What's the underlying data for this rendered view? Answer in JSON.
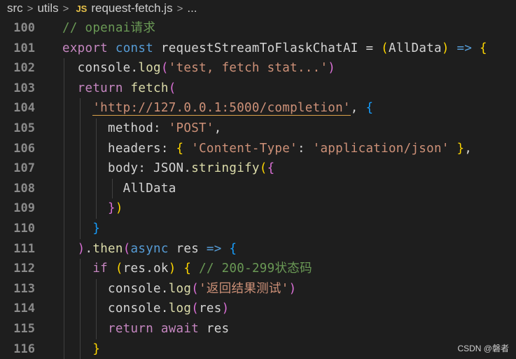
{
  "breadcrumb": {
    "items": [
      "src",
      "utils",
      "JS",
      "request-fetch.js",
      "..."
    ]
  },
  "editor": {
    "lines": [
      {
        "num": "100",
        "tokens": [
          {
            "t": "// openai请求",
            "c": "t-com"
          }
        ]
      },
      {
        "num": "101",
        "tokens": [
          {
            "t": "export",
            "c": "t-ctl"
          },
          {
            "t": " ",
            "c": "t-p"
          },
          {
            "t": "const",
            "c": "t-kw"
          },
          {
            "t": " ",
            "c": "t-p"
          },
          {
            "t": "requestStreamToFlaskChatAI",
            "c": "t-id"
          },
          {
            "t": " = ",
            "c": "t-p"
          },
          {
            "t": "(",
            "c": "t-b1"
          },
          {
            "t": "AllData",
            "c": "t-id"
          },
          {
            "t": ")",
            "c": "t-b1"
          },
          {
            "t": " ",
            "c": "t-p"
          },
          {
            "t": "=>",
            "c": "t-kw"
          },
          {
            "t": " ",
            "c": "t-p"
          },
          {
            "t": "{",
            "c": "t-b1"
          }
        ]
      },
      {
        "num": "102",
        "tokens": [
          {
            "t": "  console",
            "c": "t-id"
          },
          {
            "t": ".",
            "c": "t-p"
          },
          {
            "t": "log",
            "c": "t-fn"
          },
          {
            "t": "(",
            "c": "t-b2"
          },
          {
            "t": "'test, fetch stat...'",
            "c": "t-str"
          },
          {
            "t": ")",
            "c": "t-b2"
          }
        ]
      },
      {
        "num": "103",
        "tokens": [
          {
            "t": "  ",
            "c": "t-p"
          },
          {
            "t": "return",
            "c": "t-ctl"
          },
          {
            "t": " ",
            "c": "t-p"
          },
          {
            "t": "fetch",
            "c": "t-fn"
          },
          {
            "t": "(",
            "c": "t-b2"
          }
        ]
      },
      {
        "num": "104",
        "tokens": [
          {
            "t": "    ",
            "c": "t-p"
          },
          {
            "t": "'http://127.0.0.1:5000/completion'",
            "c": "t-str url-line"
          },
          {
            "t": ", ",
            "c": "t-p"
          },
          {
            "t": "{",
            "c": "t-b3"
          }
        ]
      },
      {
        "num": "105",
        "tokens": [
          {
            "t": "      method",
            "c": "t-id"
          },
          {
            "t": ": ",
            "c": "t-p"
          },
          {
            "t": "'POST'",
            "c": "t-str"
          },
          {
            "t": ",",
            "c": "t-p"
          }
        ]
      },
      {
        "num": "106",
        "tokens": [
          {
            "t": "      headers",
            "c": "t-id"
          },
          {
            "t": ": ",
            "c": "t-p"
          },
          {
            "t": "{",
            "c": "t-b1"
          },
          {
            "t": " ",
            "c": "t-p"
          },
          {
            "t": "'Content-Type'",
            "c": "t-str"
          },
          {
            "t": ": ",
            "c": "t-p"
          },
          {
            "t": "'application/json'",
            "c": "t-str"
          },
          {
            "t": " ",
            "c": "t-p"
          },
          {
            "t": "}",
            "c": "t-b1"
          },
          {
            "t": ",",
            "c": "t-p"
          }
        ]
      },
      {
        "num": "107",
        "tokens": [
          {
            "t": "      body",
            "c": "t-id"
          },
          {
            "t": ": ",
            "c": "t-p"
          },
          {
            "t": "JSON",
            "c": "t-id"
          },
          {
            "t": ".",
            "c": "t-p"
          },
          {
            "t": "stringify",
            "c": "t-fn"
          },
          {
            "t": "(",
            "c": "t-b1"
          },
          {
            "t": "{",
            "c": "t-b2"
          }
        ]
      },
      {
        "num": "108",
        "tokens": [
          {
            "t": "        AllData",
            "c": "t-id"
          }
        ]
      },
      {
        "num": "109",
        "tokens": [
          {
            "t": "      ",
            "c": "t-p"
          },
          {
            "t": "}",
            "c": "t-b2"
          },
          {
            "t": ")",
            "c": "t-b1"
          }
        ]
      },
      {
        "num": "110",
        "tokens": [
          {
            "t": "    ",
            "c": "t-p"
          },
          {
            "t": "}",
            "c": "t-b3"
          }
        ]
      },
      {
        "num": "111",
        "tokens": [
          {
            "t": "  ",
            "c": "t-p"
          },
          {
            "t": ")",
            "c": "t-b2"
          },
          {
            "t": ".",
            "c": "t-p"
          },
          {
            "t": "then",
            "c": "t-fn"
          },
          {
            "t": "(",
            "c": "t-b2"
          },
          {
            "t": "async",
            "c": "t-kw"
          },
          {
            "t": " res ",
            "c": "t-id"
          },
          {
            "t": "=>",
            "c": "t-kw"
          },
          {
            "t": " ",
            "c": "t-p"
          },
          {
            "t": "{",
            "c": "t-b3"
          }
        ]
      },
      {
        "num": "112",
        "tokens": [
          {
            "t": "    ",
            "c": "t-p"
          },
          {
            "t": "if",
            "c": "t-ctl"
          },
          {
            "t": " ",
            "c": "t-p"
          },
          {
            "t": "(",
            "c": "t-b1"
          },
          {
            "t": "res",
            "c": "t-id"
          },
          {
            "t": ".",
            "c": "t-p"
          },
          {
            "t": "ok",
            "c": "t-id"
          },
          {
            "t": ")",
            "c": "t-b1"
          },
          {
            "t": " ",
            "c": "t-p"
          },
          {
            "t": "{",
            "c": "t-b1"
          },
          {
            "t": " ",
            "c": "t-p"
          },
          {
            "t": "// 200-299状态码",
            "c": "t-com"
          }
        ]
      },
      {
        "num": "113",
        "tokens": [
          {
            "t": "      console",
            "c": "t-id"
          },
          {
            "t": ".",
            "c": "t-p"
          },
          {
            "t": "log",
            "c": "t-fn"
          },
          {
            "t": "(",
            "c": "t-b2"
          },
          {
            "t": "'返回结果测试'",
            "c": "t-str"
          },
          {
            "t": ")",
            "c": "t-b2"
          }
        ]
      },
      {
        "num": "114",
        "tokens": [
          {
            "t": "      console",
            "c": "t-id"
          },
          {
            "t": ".",
            "c": "t-p"
          },
          {
            "t": "log",
            "c": "t-fn"
          },
          {
            "t": "(",
            "c": "t-b2"
          },
          {
            "t": "res",
            "c": "t-id"
          },
          {
            "t": ")",
            "c": "t-b2"
          }
        ]
      },
      {
        "num": "115",
        "tokens": [
          {
            "t": "      ",
            "c": "t-p"
          },
          {
            "t": "return",
            "c": "t-ctl"
          },
          {
            "t": " ",
            "c": "t-p"
          },
          {
            "t": "await",
            "c": "t-ctl"
          },
          {
            "t": " res",
            "c": "t-id"
          }
        ]
      },
      {
        "num": "116",
        "tokens": [
          {
            "t": "    ",
            "c": "t-p"
          },
          {
            "t": "}",
            "c": "t-b1"
          }
        ]
      }
    ]
  },
  "watermark": "CSDN @磐者"
}
